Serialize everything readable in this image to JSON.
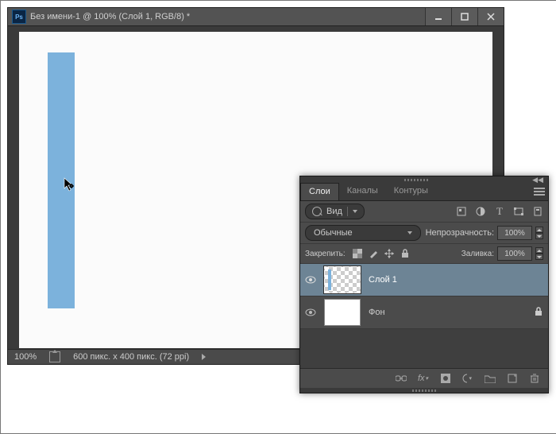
{
  "window": {
    "app_icon_text": "Ps",
    "title": "Без имени-1 @ 100% (Слой 1, RGB/8) *"
  },
  "statusbar": {
    "zoom": "100%",
    "info": "600 пикс. x 400 пикс. (72 ppi)"
  },
  "panel": {
    "tabs": {
      "layers": "Слои",
      "channels": "Каналы",
      "paths": "Контуры"
    },
    "search_kind": "Вид",
    "blend_mode": "Обычные",
    "opacity_label": "Непрозрачность:",
    "opacity_value": "100%",
    "lock_label": "Закрепить:",
    "fill_label": "Заливка:",
    "fill_value": "100%",
    "layers": [
      {
        "name": "Слой 1"
      },
      {
        "name": "Фон"
      }
    ]
  }
}
